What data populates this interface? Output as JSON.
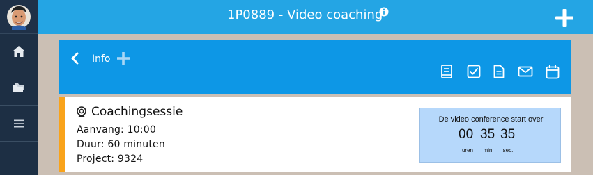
{
  "app": {
    "title": "1P0889 - Video coaching",
    "icons": {
      "info": "info-icon",
      "add": "plus-icon"
    }
  },
  "sidebar": {
    "items": [
      {
        "icon": "avatar"
      },
      {
        "icon": "home-icon"
      },
      {
        "icon": "folder-icon"
      },
      {
        "icon": "menu-icon"
      }
    ]
  },
  "header": {
    "title": "Info",
    "toolbar": [
      "book-icon",
      "checkbox-icon",
      "document-icon",
      "mail-icon",
      "calendar-icon"
    ]
  },
  "session": {
    "title": "Coachingsessie",
    "start": "Aanvang: 10:00",
    "duration": "Duur: 60 minuten",
    "project": "Project: 9324",
    "accent_color": "#f9a31b"
  },
  "countdown": {
    "label": "De video conference start over",
    "hours": "00",
    "minutes": "35",
    "seconds": "35",
    "hours_unit": "uren",
    "minutes_unit": "min.",
    "seconds_unit": "sec."
  },
  "colors": {
    "topbar": "#24a5e4",
    "header": "#0d97e6",
    "sidebar": "#1d2f44",
    "background": "#cbbfb4",
    "timer_bg": "#b6d8fb"
  }
}
